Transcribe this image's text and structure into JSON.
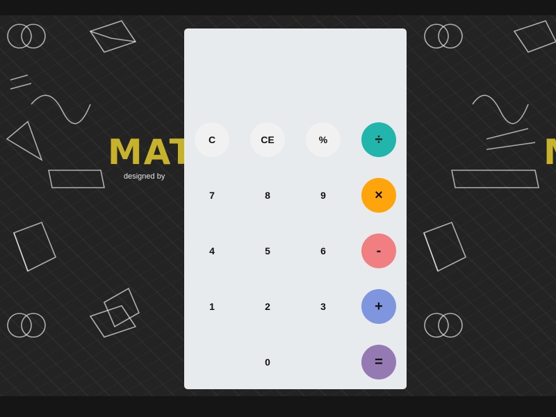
{
  "background": {
    "headline": "MAT",
    "headline_right": "M",
    "credit": "designed by",
    "colors": {
      "board": "#232323",
      "headline": "#c7b22c"
    }
  },
  "calculator": {
    "display": "",
    "keys": {
      "clear": "C",
      "clear_entry": "CE",
      "percent": "%",
      "divide": "÷",
      "seven": "7",
      "eight": "8",
      "nine": "9",
      "multiply": "×",
      "four": "4",
      "five": "5",
      "six": "6",
      "subtract": "-",
      "one": "1",
      "two": "2",
      "three": "3",
      "add": "+",
      "zero": "0",
      "equals": "="
    },
    "colors": {
      "panel": "#e8ebee",
      "function_key": "#f1f1f1",
      "divide": "#21b5ab",
      "multiply": "#ffa40a",
      "subtract": "#f17e80",
      "add": "#7f95de",
      "equals": "#9579b3"
    }
  }
}
